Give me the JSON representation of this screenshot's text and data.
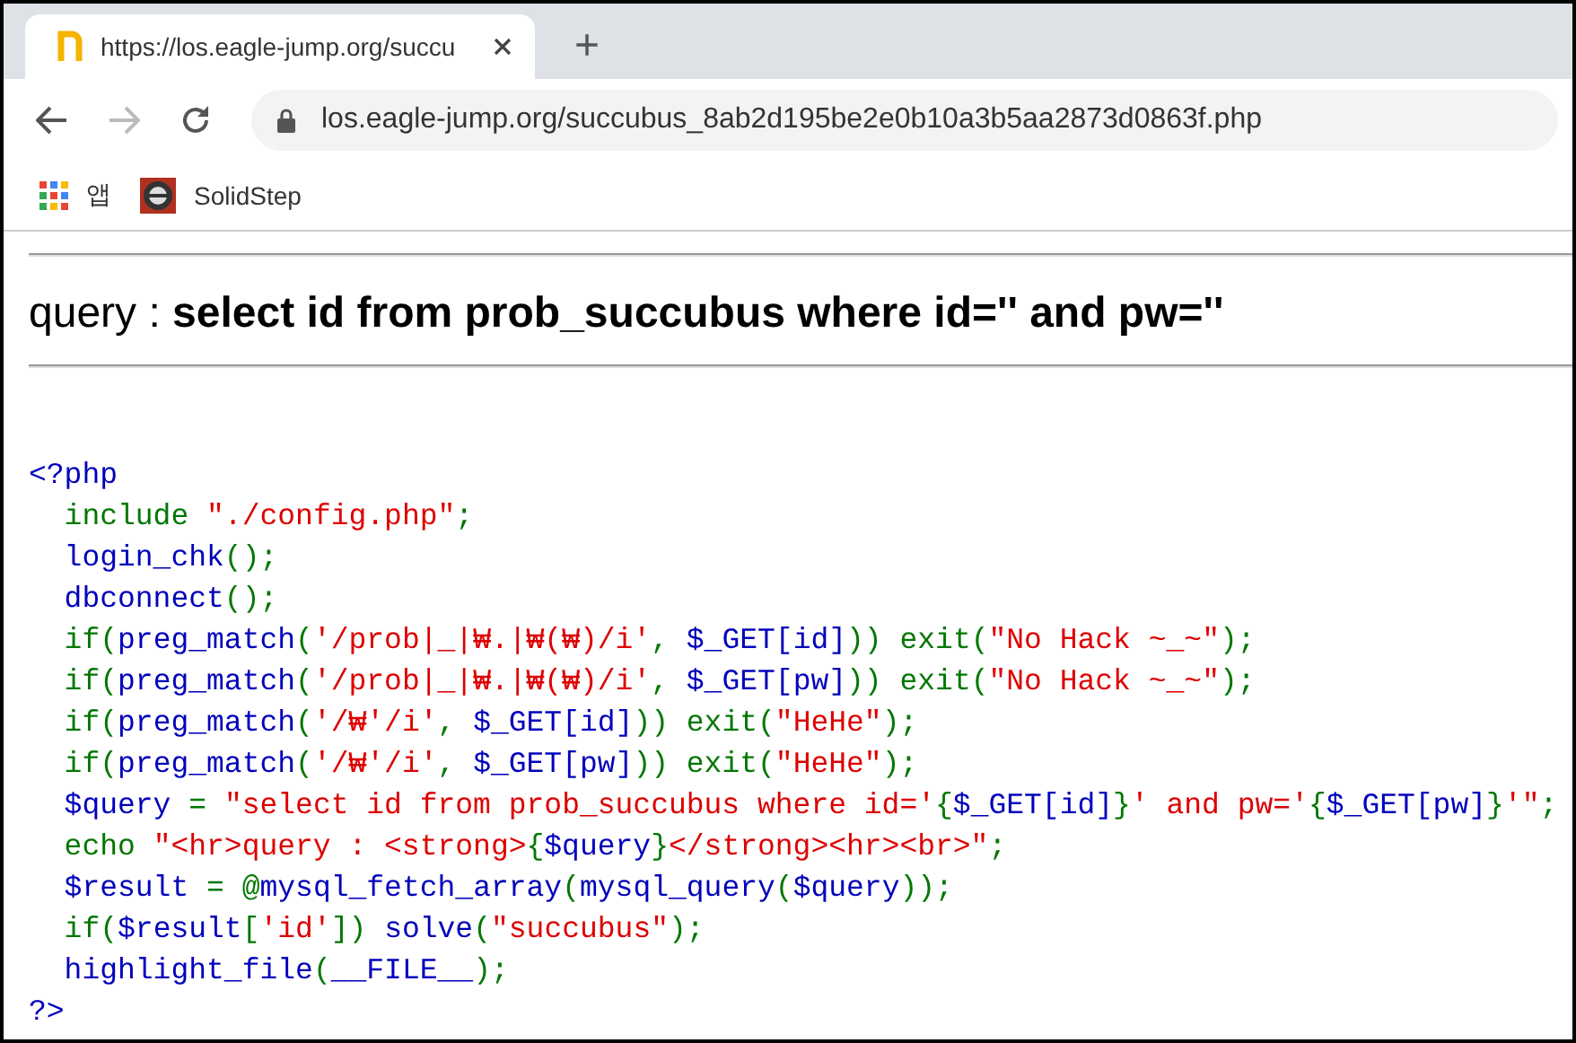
{
  "tab": {
    "title": "https://los.eagle-jump.org/succu",
    "new_tab": "+"
  },
  "address_bar": {
    "url": "los.eagle-jump.org/succubus_8ab2d195be2e0b10a3b5aa2873d0863f.php"
  },
  "bookmarks": [
    {
      "label": "앱",
      "kind": "apps"
    },
    {
      "label": "SolidStep",
      "kind": "site"
    }
  ],
  "query": {
    "label": "query : ",
    "text": "select id from prob_succubus where id='' and pw=''"
  },
  "code_lines": [
    [
      {
        "text": "<?php",
        "kind": "default"
      }
    ],
    [
      {
        "text": "  include ",
        "kind": "keyword"
      },
      {
        "text": "\"./config.php\"",
        "kind": "string"
      },
      {
        "text": ";",
        "kind": "keyword"
      }
    ],
    [
      {
        "text": "  login_chk",
        "kind": "default"
      },
      {
        "text": "();",
        "kind": "keyword"
      }
    ],
    [
      {
        "text": "  dbconnect",
        "kind": "default"
      },
      {
        "text": "();",
        "kind": "keyword"
      }
    ],
    [
      {
        "text": "  if(",
        "kind": "keyword"
      },
      {
        "text": "preg_match",
        "kind": "default"
      },
      {
        "text": "(",
        "kind": "keyword"
      },
      {
        "text": "'/prob|_|₩.|₩(₩)/i'",
        "kind": "string"
      },
      {
        "text": ", ",
        "kind": "keyword"
      },
      {
        "text": "$_GET[id]",
        "kind": "default"
      },
      {
        "text": ")) exit(",
        "kind": "keyword"
      },
      {
        "text": "\"No Hack ~_~\"",
        "kind": "string"
      },
      {
        "text": ");",
        "kind": "keyword"
      }
    ],
    [
      {
        "text": "  if(",
        "kind": "keyword"
      },
      {
        "text": "preg_match",
        "kind": "default"
      },
      {
        "text": "(",
        "kind": "keyword"
      },
      {
        "text": "'/prob|_|₩.|₩(₩)/i'",
        "kind": "string"
      },
      {
        "text": ", ",
        "kind": "keyword"
      },
      {
        "text": "$_GET[pw]",
        "kind": "default"
      },
      {
        "text": ")) exit(",
        "kind": "keyword"
      },
      {
        "text": "\"No Hack ~_~\"",
        "kind": "string"
      },
      {
        "text": ");",
        "kind": "keyword"
      }
    ],
    [
      {
        "text": "  if(",
        "kind": "keyword"
      },
      {
        "text": "preg_match",
        "kind": "default"
      },
      {
        "text": "(",
        "kind": "keyword"
      },
      {
        "text": "'/₩'/i'",
        "kind": "string"
      },
      {
        "text": ", ",
        "kind": "keyword"
      },
      {
        "text": "$_GET[id]",
        "kind": "default"
      },
      {
        "text": ")) exit(",
        "kind": "keyword"
      },
      {
        "text": "\"HeHe\"",
        "kind": "string"
      },
      {
        "text": ");",
        "kind": "keyword"
      }
    ],
    [
      {
        "text": "  if(",
        "kind": "keyword"
      },
      {
        "text": "preg_match",
        "kind": "default"
      },
      {
        "text": "(",
        "kind": "keyword"
      },
      {
        "text": "'/₩'/i'",
        "kind": "string"
      },
      {
        "text": ", ",
        "kind": "keyword"
      },
      {
        "text": "$_GET[pw]",
        "kind": "default"
      },
      {
        "text": ")) exit(",
        "kind": "keyword"
      },
      {
        "text": "\"HeHe\"",
        "kind": "string"
      },
      {
        "text": ");",
        "kind": "keyword"
      }
    ],
    [
      {
        "text": "  $query ",
        "kind": "default"
      },
      {
        "text": "= ",
        "kind": "keyword"
      },
      {
        "text": "\"select id from prob_succubus where id='",
        "kind": "string"
      },
      {
        "text": "{",
        "kind": "keyword"
      },
      {
        "text": "$_GET[id]",
        "kind": "default"
      },
      {
        "text": "}",
        "kind": "keyword"
      },
      {
        "text": "' and pw='",
        "kind": "string"
      },
      {
        "text": "{",
        "kind": "keyword"
      },
      {
        "text": "$_GET[pw]",
        "kind": "default"
      },
      {
        "text": "}",
        "kind": "keyword"
      },
      {
        "text": "'\"",
        "kind": "string"
      },
      {
        "text": ";",
        "kind": "keyword"
      }
    ],
    [
      {
        "text": "  echo ",
        "kind": "keyword"
      },
      {
        "text": "\"<hr>query : <strong>",
        "kind": "string"
      },
      {
        "text": "{",
        "kind": "keyword"
      },
      {
        "text": "$query",
        "kind": "default"
      },
      {
        "text": "}",
        "kind": "keyword"
      },
      {
        "text": "</strong><hr><br>\"",
        "kind": "string"
      },
      {
        "text": ";",
        "kind": "keyword"
      }
    ],
    [
      {
        "text": "  $result ",
        "kind": "default"
      },
      {
        "text": "= @",
        "kind": "keyword"
      },
      {
        "text": "mysql_fetch_array",
        "kind": "default"
      },
      {
        "text": "(",
        "kind": "keyword"
      },
      {
        "text": "mysql_query",
        "kind": "default"
      },
      {
        "text": "(",
        "kind": "keyword"
      },
      {
        "text": "$query",
        "kind": "default"
      },
      {
        "text": "));",
        "kind": "keyword"
      }
    ],
    [
      {
        "text": "  if(",
        "kind": "keyword"
      },
      {
        "text": "$result",
        "kind": "default"
      },
      {
        "text": "[",
        "kind": "keyword"
      },
      {
        "text": "'id'",
        "kind": "string"
      },
      {
        "text": "]) ",
        "kind": "keyword"
      },
      {
        "text": "solve",
        "kind": "default"
      },
      {
        "text": "(",
        "kind": "keyword"
      },
      {
        "text": "\"succubus\"",
        "kind": "string"
      },
      {
        "text": ");",
        "kind": "keyword"
      }
    ],
    [
      {
        "text": "  highlight_file",
        "kind": "default"
      },
      {
        "text": "(",
        "kind": "keyword"
      },
      {
        "text": "__FILE__",
        "kind": "default"
      },
      {
        "text": ");",
        "kind": "keyword"
      }
    ],
    [
      {
        "text": "?>",
        "kind": "default"
      }
    ]
  ]
}
